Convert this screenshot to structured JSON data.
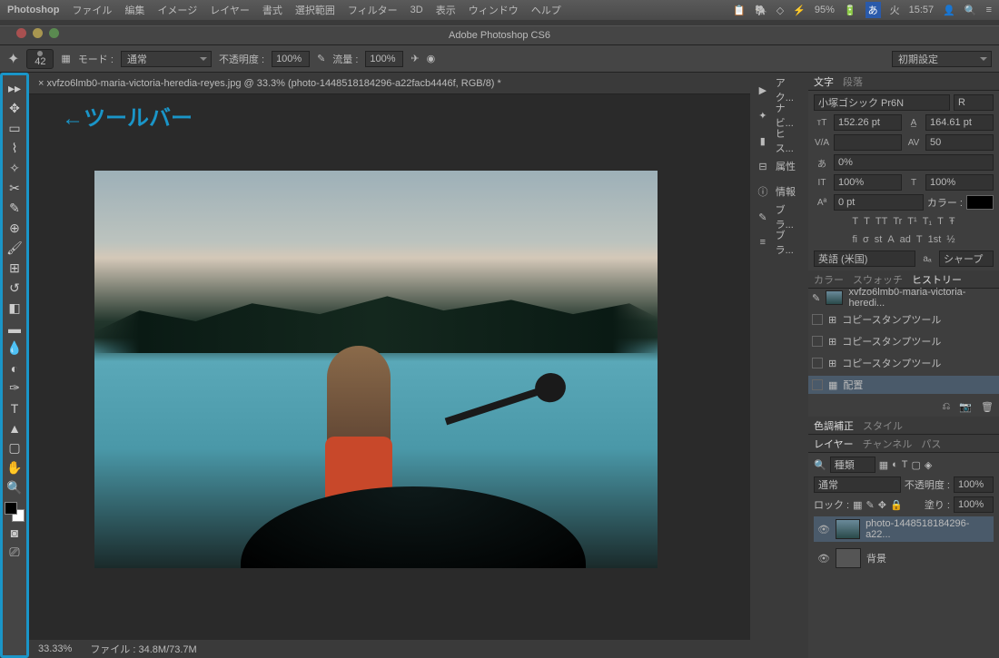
{
  "menubar": {
    "app": "Photoshop",
    "items": [
      "ファイル",
      "編集",
      "イメージ",
      "レイヤー",
      "書式",
      "選択範囲",
      "フィルター",
      "3D",
      "表示",
      "ウィンドウ",
      "ヘルプ"
    ],
    "right": {
      "battery": "95%",
      "ime": "あ",
      "day": "火",
      "time": "15:57"
    }
  },
  "window": {
    "title": "Adobe Photoshop CS6"
  },
  "optbar": {
    "brush_size": "42",
    "mode_label": "モード :",
    "mode_value": "通常",
    "opacity_label": "不透明度 :",
    "opacity_value": "100%",
    "flow_label": "流量 :",
    "flow_value": "100%",
    "preset": "初期設定"
  },
  "annotation": "←ツールバー",
  "doc_tab": "× xvfzo6lmb0-maria-victoria-heredia-reyes.jpg @ 33.3% (photo-1448518184296-a22facb4446f, RGB/8) *",
  "status": {
    "zoom": "33.33%",
    "file_label": "ファイル :",
    "file_value": "34.8M/73.7M"
  },
  "mid_panels": [
    "アク...",
    "ナビ...",
    "ヒス...",
    "属性",
    "情報",
    "ブラ...",
    "ブラ..."
  ],
  "char_panel": {
    "tabs": [
      "文字",
      "段落"
    ],
    "font": "小塚ゴシック Pr6N",
    "style": "R",
    "size": "152.26 pt",
    "leading": "164.61 pt",
    "tracking_va": "",
    "tracking_av": "50",
    "scale": "0%",
    "vert_scale": "100%",
    "horz_scale": "100%",
    "baseline": "0 pt",
    "color_label": "カラー :",
    "lang": "英語 (米国)",
    "aa": "シャープ"
  },
  "txt_btns1": [
    "T",
    "T",
    "TT",
    "Tr",
    "T¹",
    "T₁",
    "T",
    "Ŧ"
  ],
  "txt_btns2": [
    "fi",
    "σ",
    "st",
    "A",
    "ad",
    "T",
    "1st",
    "½"
  ],
  "swatch_tabs": [
    "カラー",
    "スウォッチ",
    "ヒストリー"
  ],
  "history": [
    {
      "label": "xvfzo6lmb0-maria-victoria-heredi...",
      "hasThumb": true
    },
    {
      "label": "コピースタンプツール"
    },
    {
      "label": "コピースタンプツール"
    },
    {
      "label": "コピースタンプツール"
    },
    {
      "label": "配置",
      "active": true
    }
  ],
  "adjust_tabs": [
    "色調補正",
    "スタイル"
  ],
  "layer_tabs": [
    "レイヤー",
    "チャンネル",
    "パス"
  ],
  "layers": {
    "kind": "種類",
    "blend": "通常",
    "opacity_label": "不透明度 :",
    "opacity": "100%",
    "lock_label": "ロック :",
    "fill_label": "塗り :",
    "fill": "100%",
    "items": [
      {
        "name": "photo-1448518184296-a22...",
        "thumb": "photo"
      },
      {
        "name": "背景",
        "thumb": "bg"
      }
    ]
  },
  "chart_data": null
}
